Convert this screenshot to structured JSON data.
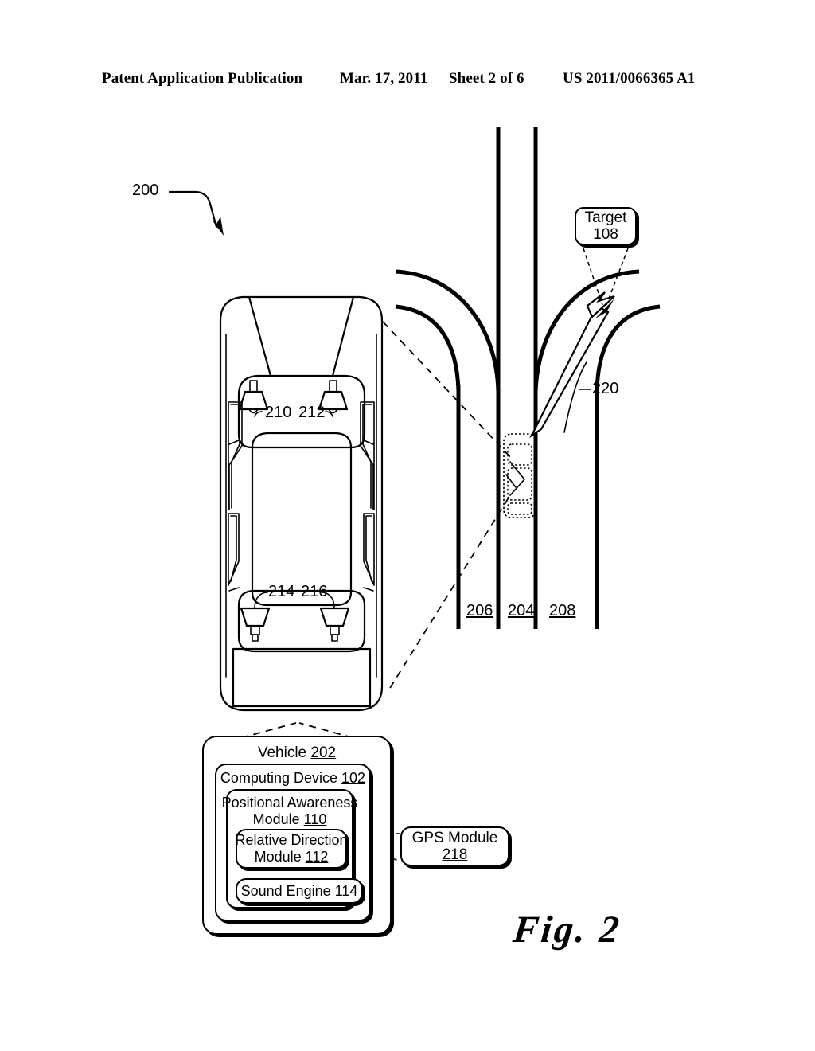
{
  "header": {
    "publication": "Patent Application Publication",
    "date": "Mar. 17, 2011",
    "sheet": "Sheet 2 of 6",
    "patent_number": "US 2011/0066365 A1"
  },
  "figure": {
    "caption": "Fig. 2",
    "figure_ref": "200"
  },
  "callouts": {
    "target": {
      "label": "Target",
      "number": "108"
    },
    "gps": {
      "label": "GPS Module",
      "number": "218"
    },
    "vehicle": {
      "label": "Vehicle",
      "number": "202"
    },
    "computing_device": {
      "label": "Computing Device",
      "number": "102"
    },
    "positional_awareness": {
      "line1": "Positional Awareness",
      "line2": "Module",
      "number": "110"
    },
    "relative_direction": {
      "line1": "Relative Direction",
      "line2": "Module",
      "number": "112"
    },
    "sound_engine": {
      "label": "Sound Engine",
      "number": "114"
    }
  },
  "speakers": {
    "front_left": "210",
    "front_right": "212",
    "rear_left": "214",
    "rear_right": "216"
  },
  "roads": {
    "lane_left": "206",
    "lane_center": "204",
    "lane_right": "208",
    "route_arrow": "220"
  },
  "colors": {
    "ink": "#000000",
    "paper": "#ffffff"
  }
}
